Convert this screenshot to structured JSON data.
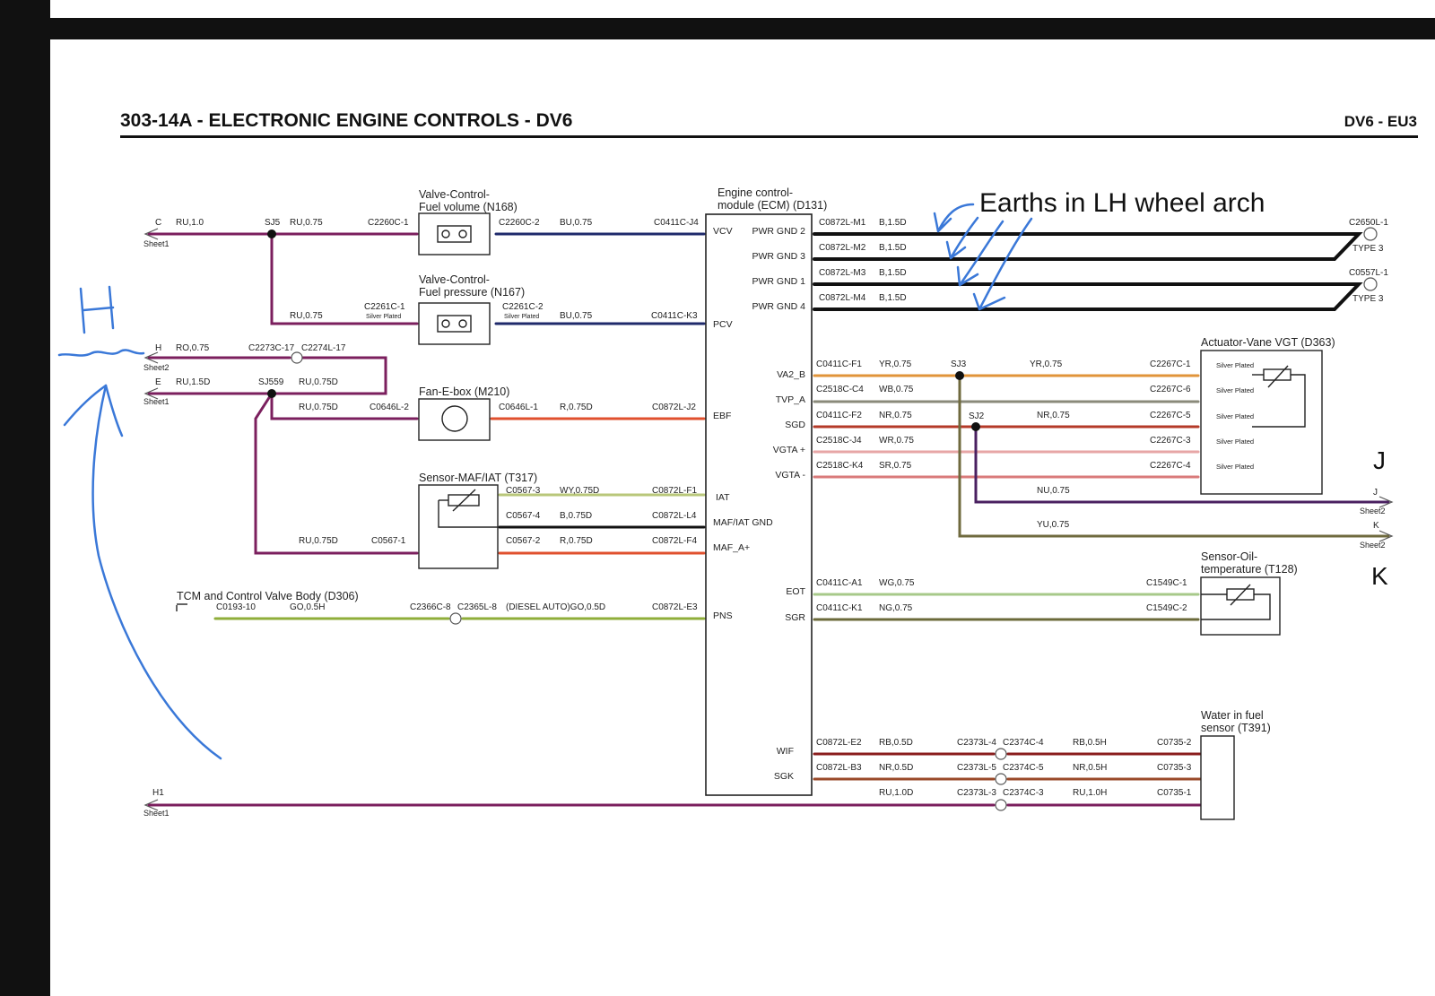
{
  "header": {
    "title": "303-14A - ELECTRONIC ENGINE CONTROLS - DV6",
    "model": "DV6 - EU3"
  },
  "components": {
    "n168": {
      "line1": "Valve-Control-",
      "line2": "Fuel volume (N168)"
    },
    "n167": {
      "line1": "Valve-Control-",
      "line2": "Fuel pressure (N167)"
    },
    "m210": "Fan-E-box (M210)",
    "t317": "Sensor-MAF/IAT (T317)",
    "d306": "TCM and Control Valve Body (D306)",
    "ecm": {
      "line1": "Engine control-",
      "line2": "module (ECM) (D131)"
    },
    "d363": "Actuator-Vane VGT (D363)",
    "t128": {
      "line1": "Sensor-Oil-",
      "line2": "temperature (T128)"
    },
    "t391": {
      "line1": "Water in fuel",
      "line2": "sensor (T391)"
    }
  },
  "ecm_pins_left": [
    "VCV",
    "PCV",
    "EBF",
    "IAT",
    "MAF/IAT GND",
    "MAF_A+",
    "PNS"
  ],
  "ecm_pins_right": [
    "PWR GND 2",
    "PWR GND 3",
    "PWR GND 1",
    "PWR GND 4",
    "VA2_B",
    "TVP_A",
    "SGD",
    "VGTA +",
    "VGTA -",
    "EOT",
    "SGR",
    "WIF",
    "SGK"
  ],
  "offsheet": {
    "c": {
      "letter": "C",
      "wire": "RU,1.0",
      "sheet": "Sheet1"
    },
    "h": {
      "letter": "H",
      "wire": "RO,0.75",
      "sheet": "Sheet2"
    },
    "e": {
      "letter": "E",
      "wire": "RU,1.5D",
      "sheet": "Sheet1"
    },
    "h1": {
      "letter": "H1",
      "sheet": "Sheet1"
    },
    "j": {
      "letter": "J",
      "sheet": "Sheet2"
    },
    "k": {
      "letter": "K",
      "sheet": "Sheet2"
    }
  },
  "splices": {
    "sj5": "SJ5",
    "sj559": "SJ559",
    "sj3": "SJ3",
    "sj2": "SJ2"
  },
  "labels": {
    "w_sj5": "RU,0.75",
    "c2260c1": "C2260C-1",
    "c2260c2": "C2260C-2",
    "bu1": "BU,0.75",
    "c0411cj4": "C0411C-J4",
    "ru_vert": "RU,0.75",
    "c2261c1": "C2261C-1",
    "sp1": "Silver Plated",
    "c2261c2": "C2261C-2",
    "sp2": "Silver Plated",
    "bu2": "BU,0.75",
    "c0411ck3": "C0411C-K3",
    "c2273c": "C2273C-17",
    "c2274l": "C2274L-17",
    "ru075d_a": "RU,0.75D",
    "ru075d_b": "RU,0.75D",
    "c0646l2": "C0646L-2",
    "c0646l1": "C0646L-1",
    "r075d_a": "R,0.75D",
    "c0872lj2": "C0872L-J2",
    "c05673": "C0567-3",
    "wy": "WY,0.75D",
    "c0872lf1": "C0872L-F1",
    "c05674": "C0567-4",
    "b075d": "B,0.75D",
    "c0872ll4": "C0872L-L4",
    "ru075d_c": "RU,0.75D",
    "c05671": "C0567-1",
    "c05672": "C0567-2",
    "r075d_b": "R,0.75D",
    "c0872lf4": "C0872L-F4",
    "c019310": "C0193-10",
    "go05h": "GO,0.5H",
    "c2366c": "C2366C-8",
    "c2365l": "C2365L-8",
    "diesel": "(DIESEL AUTO)GO,0.5D",
    "c0872le3": "C0872L-E3",
    "m1": "C0872L-M1",
    "m2": "C0872L-M2",
    "m3": "C0872L-M3",
    "m4": "C0872L-M4",
    "b15d": "B,1.5D",
    "c2650l1": "C2650L-1",
    "c0557l1": "C0557L-1",
    "type3": "TYPE 3",
    "f1": "C0411C-F1",
    "yr075_a": "YR,0.75",
    "yr075_b": "YR,0.75",
    "c2267c1": "C2267C-1",
    "c4": "C2518C-C4",
    "wb075": "WB,0.75",
    "c2267c6": "C2267C-6",
    "f2": "C0411C-F2",
    "nr075_a": "NR,0.75",
    "nr075_b": "NR,0.75",
    "c2267c5": "C2267C-5",
    "j4": "C2518C-J4",
    "wr075": "WR,0.75",
    "c2267c3": "C2267C-3",
    "k4": "C2518C-K4",
    "sr075": "SR,0.75",
    "c2267c4": "C2267C-4",
    "nu075": "NU,0.75",
    "yu075": "YU,0.75",
    "a1": "C0411C-A1",
    "wg075": "WG,0.75",
    "c1549c1": "C1549C-1",
    "k1": "C0411C-K1",
    "ng075": "NG,0.75",
    "c1549c2": "C1549C-2",
    "e2": "C0872L-E2",
    "rb05d": "RB,0.5D",
    "c2373l4": "C2373L-4",
    "c2374c4": "C2374C-4",
    "rb05h": "RB,0.5H",
    "c07352": "C0735-2",
    "b3": "C0872L-B3",
    "nr05d": "NR,0.5D",
    "c2373l5": "C2373L-5",
    "c2374c5": "C2374C-5",
    "nr05h": "NR,0.5H",
    "c07353": "C0735-3",
    "ru10d": "RU,1.0D",
    "c2373l3": "C2373L-3",
    "c2374c3": "C2374C-3",
    "ru10h": "RU,1.0H",
    "c07351": "C0735-1"
  },
  "annotations": {
    "earths": "Earths in LH wheel arch",
    "h_mark": "H",
    "j_mark": "J",
    "k_mark": "K"
  },
  "colors": {
    "purple": "#7b1f5e",
    "navy": "#1f2a6b",
    "orange": "#e0502e",
    "yellow_orange": "#e1943a",
    "green": "#8fae3a",
    "olive": "#6f6a3e",
    "pen_blue": "#3a78d8"
  }
}
